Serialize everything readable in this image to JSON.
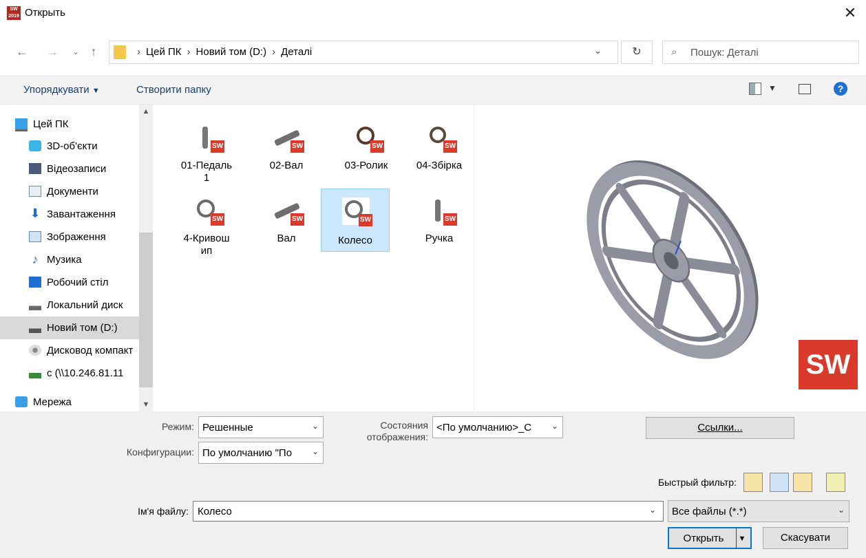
{
  "window": {
    "title": "Открыть",
    "app_icon_text": "2019"
  },
  "address": {
    "crumbs": [
      "Цей ПК",
      "Новий том (D:)",
      "Деталі"
    ]
  },
  "search": {
    "placeholder": "Пошук: Деталі"
  },
  "toolbar": {
    "organize": "Упорядкувати",
    "new_folder": "Створити папку"
  },
  "sidebar": {
    "items": [
      {
        "label": "Цей ПК",
        "icon": "computer-icon"
      },
      {
        "label": "3D-об'єкти",
        "icon": "3d-objects-icon"
      },
      {
        "label": "Відеозаписи",
        "icon": "videos-icon"
      },
      {
        "label": "Документи",
        "icon": "documents-icon"
      },
      {
        "label": "Завантаження",
        "icon": "downloads-icon"
      },
      {
        "label": "Зображення",
        "icon": "pictures-icon"
      },
      {
        "label": "Музика",
        "icon": "music-icon"
      },
      {
        "label": "Робочий стіл",
        "icon": "desktop-icon"
      },
      {
        "label": "Локальний диск",
        "icon": "local-disk-icon"
      },
      {
        "label": "Новий том (D:)",
        "icon": "drive-icon",
        "selected": true
      },
      {
        "label": "Дисковод компакт",
        "icon": "cd-drive-icon"
      },
      {
        "label": "c (\\\\10.246.81.11",
        "icon": "network-drive-icon"
      },
      {
        "label": "Мережа",
        "icon": "network-icon"
      }
    ]
  },
  "files": [
    {
      "line1": "01-Педаль",
      "line2": "1",
      "kind": "part-pedal"
    },
    {
      "line1": "02-Вал",
      "line2": "",
      "kind": "part-shaft"
    },
    {
      "line1": "03-Ролик",
      "line2": "",
      "kind": "part-wheel"
    },
    {
      "line1": "04-Збірка",
      "line2": "",
      "kind": "assembly"
    },
    {
      "line1": "4-Кривош",
      "line2": "ип",
      "kind": "part-wheel"
    },
    {
      "line1": "Вал",
      "line2": "",
      "kind": "part-shaft"
    },
    {
      "line1": "Колесо",
      "line2": "",
      "kind": "part-wheel",
      "selected": true
    },
    {
      "line1": "Ручка",
      "line2": "",
      "kind": "part-pedal"
    }
  ],
  "options": {
    "mode_label": "Режим:",
    "mode_value": "Решенные",
    "display_states_label_1": "Состояния",
    "display_states_label_2": "отображения:",
    "display_states_value": "<По умолчанию>_С",
    "config_label": "Конфигурации:",
    "config_value": "По умолчанию  \"По",
    "references_button": "Ссылки...",
    "quick_filter_label": "Быстрый фильтр:"
  },
  "footer": {
    "filename_label": "Ім'я файлу:",
    "filename_value": "Колесо",
    "filetype_value": "Все файлы (*.*)",
    "open_button": "Открыть",
    "cancel_button": "Скасувати"
  },
  "colors": {
    "accent": "#1e70d0",
    "selection": "#cce8ff",
    "sw_red": "#d93a2b"
  }
}
